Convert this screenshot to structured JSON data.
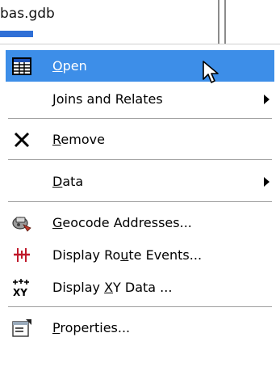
{
  "background": {
    "title": "bas.gdb"
  },
  "menu": {
    "items": [
      {
        "prefix": "",
        "ul": "O",
        "suffix": "pen",
        "icon": "table-icon",
        "highlighted": true
      },
      {
        "prefix": "",
        "ul": "J",
        "suffix": "oins and Relates",
        "submenu": true
      },
      {
        "prefix": "",
        "ul": "R",
        "suffix": "emove",
        "icon": "remove-x-icon"
      },
      {
        "prefix": "",
        "ul": "D",
        "suffix": "ata",
        "submenu": true
      },
      {
        "prefix": "",
        "ul": "G",
        "suffix": "eocode Addresses...",
        "icon": "geocode-icon"
      },
      {
        "prefix": "Display Ro",
        "ul": "u",
        "suffix": "te Events...",
        "icon": "route-events-icon"
      },
      {
        "prefix": "Display ",
        "ul": "X",
        "suffix": "Y Data ...",
        "icon": "xy-data-icon"
      },
      {
        "prefix": "",
        "ul": "P",
        "suffix": "roperties...",
        "icon": "properties-icon"
      }
    ]
  },
  "colors": {
    "highlight": "#3d8ee8",
    "selection_bar": "#2f6fd6"
  }
}
